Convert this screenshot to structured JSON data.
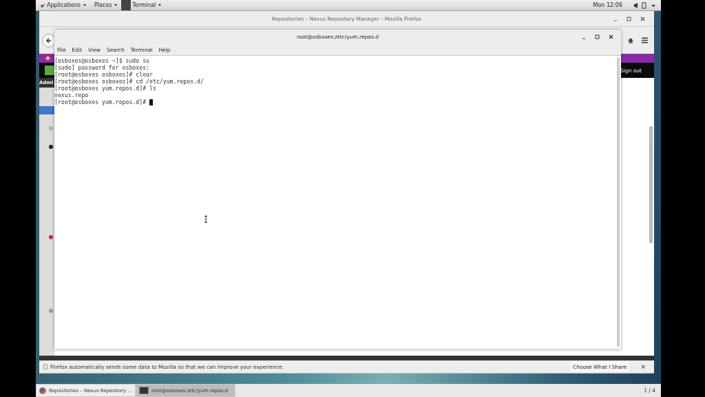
{
  "top_bar": {
    "menus": [
      {
        "label": "Applications",
        "kind": "apps"
      },
      {
        "label": "Places",
        "kind": "plain"
      },
      {
        "label": "Terminal",
        "kind": "app"
      }
    ],
    "clock": "Mon 12:06"
  },
  "browser": {
    "title": "Repositories – Nexus Repository Manager – Mozilla Firefox",
    "sidebar_label": "Admi",
    "sign_out": "Sign out",
    "notification": {
      "message": "Firefox automatically sends some data to Mozilla so that we can improve your experience.",
      "button": "Choose What I Share",
      "close": "×"
    }
  },
  "terminal": {
    "title": "root@osboxes:/etc/yum.repos.d",
    "menu": [
      "File",
      "Edit",
      "View",
      "Search",
      "Terminal",
      "Help"
    ],
    "lines": [
      "[osboxes@osboxes ~]$ sudo su",
      "[sudo] password for osboxes:",
      "[root@osboxes osboxes]# clear",
      "[root@osboxes osboxes]# cd /etc/yum.repos.d/",
      "[root@osboxes yum.repos.d]# ls",
      "nexus.repo"
    ],
    "prompt": "[root@osboxes yum.repos.d]#"
  },
  "taskbar": {
    "tasks": [
      {
        "label": "Repositories – Nexus Repository ...",
        "kind": "firefox",
        "selected": false
      },
      {
        "label": "root@osboxes:/etc/yum.repos.d",
        "kind": "terminal",
        "selected": true
      }
    ],
    "workspace": "1 / 4"
  }
}
